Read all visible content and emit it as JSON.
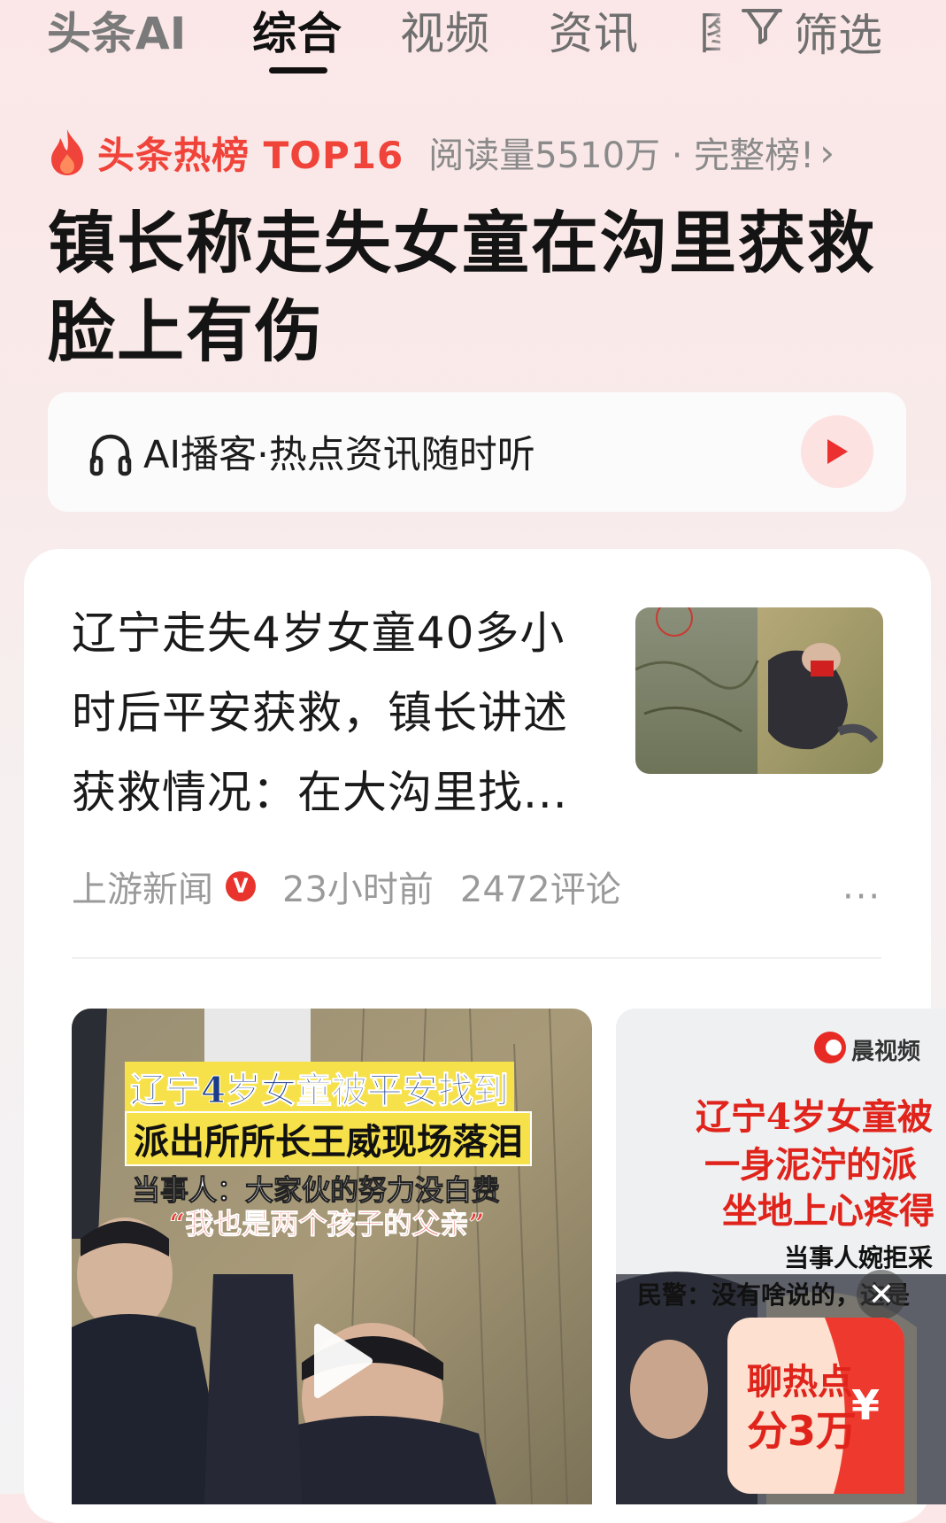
{
  "tabs": {
    "logo": "头条AI",
    "items": [
      "综合",
      "视频",
      "资讯",
      "图"
    ],
    "active_index": 0,
    "filter_label": "筛选"
  },
  "hot": {
    "title": "头条热榜 TOP16",
    "meta": "阅读量5510万 · 完整榜!",
    "chevron": "›"
  },
  "headline": "镇长称走失女童在沟里获救脸上有伤",
  "podcast": {
    "label": "AI播客·热点资讯随时听"
  },
  "article": {
    "title": "辽宁走失4岁女童40多小时后平安获救，镇长讲述获救情况：在大沟里找...",
    "source": "上游新闻",
    "verified_badge": "V",
    "time": "23小时前",
    "comments": "2472评论",
    "more": "···"
  },
  "video1": {
    "line1": "辽宁4岁女童被平安找到",
    "line2": "派出所所长王威现场落泪",
    "line3": "当事人：大家伙的努力没白费",
    "line4": "“我也是两个孩子的父亲”"
  },
  "video2": {
    "brand": "晨视频",
    "line1": "辽宁4岁女童被",
    "line2": "一身泥泞的派",
    "line3": "坐地上心疼得",
    "line4": "当事人婉拒采",
    "line5": "民警：没有啥说的，这是"
  },
  "red_packet": {
    "line1": "聊热点",
    "line2": "分3万",
    "currency": "¥"
  },
  "colors": {
    "accent": "#f0433a",
    "text": "#141414",
    "muted": "#8a8a8a"
  }
}
